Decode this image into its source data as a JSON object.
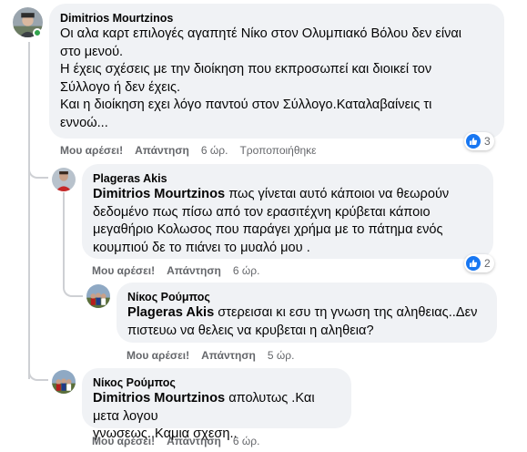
{
  "comments": [
    {
      "author": "Dimitrios Mourtzinos",
      "text_lines": [
        "Οι αλα καρτ επιλογές αγαπητέ Νίκο στον Ολυμπιακό Βόλου δεν είναι",
        "στο μενού.",
        "Η έχεις σχέσεις με την διοίκηση που εκπροσωπεί και διοικεί τον",
        "Σύλλογο ή δεν έχεις.",
        "Και η διοίκηση εχει λόγο παντού στον Σύλλογο.Καταλαβαίνεις τι",
        "εννοώ..."
      ],
      "like_label": "Μου αρέσει!",
      "reply_label": "Απάντηση",
      "time": "6 ώρ.",
      "edited": "Τροποποιήθηκε",
      "reaction_count": "3",
      "online": true
    },
    {
      "author": "Plageras Akis",
      "mention": "Dimitrios Mourtzinos",
      "text_lines_first_rest": " πως γίνεται αυτό κάποιοι να θεωρούν",
      "text_lines": [
        "δεδομένο πως πίσω από τον ερασιτέχνη κρύβεται κάποιο",
        "μεγαθήριο Κολωσος που παράγει χρήμα με το πάτημα ενός",
        "κουμπιού δε το πιάνει το μυαλό μου ."
      ],
      "like_label": "Μου αρέσει!",
      "reply_label": "Απάντηση",
      "time": "6 ώρ.",
      "reaction_count": "2"
    },
    {
      "author": "Νίκος Ρούμπος",
      "mention": "Plageras Akis",
      "text_lines_first_rest": " στερεισαι κι εσυ τη γνωση της αληθειας..Δεν",
      "text_lines": [
        "πιστευω να θελεις να κρυβεται η αληθεια?"
      ],
      "like_label": "Μου αρέσει!",
      "reply_label": "Απάντηση",
      "time": "5 ώρ."
    },
    {
      "author": "Νίκος Ρούμπος",
      "mention": "Dimitrios Mourtzinos",
      "text_lines_first_rest": " απολυτως .Και μετα λογου",
      "text_lines": [
        "γνωσεως..Καμια σχεση.."
      ],
      "like_label": "Μου αρέσει!",
      "reply_label": "Απάντηση",
      "time": "6 ώρ."
    }
  ],
  "colors": {
    "bubble": "#f0f2f5",
    "secondary_text": "#65676b",
    "like_blue": "#1877f2",
    "online_green": "#31a24c",
    "thread_line": "#ced0d4"
  },
  "icons": {
    "like": "like-thumb-icon",
    "avatar": "profile-photo"
  }
}
